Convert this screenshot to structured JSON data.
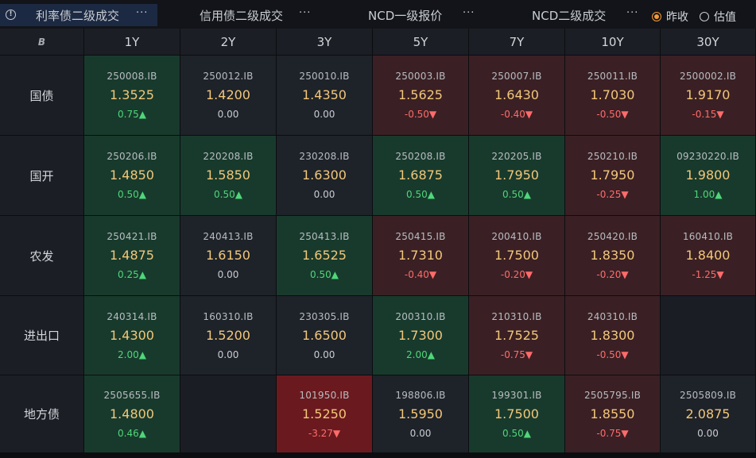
{
  "tabs": [
    {
      "label": "利率债二级成交",
      "active": true
    },
    {
      "label": "信用债二级成交",
      "active": false
    },
    {
      "label": "NCD一级报价",
      "active": false
    },
    {
      "label": "NCD二级成交",
      "active": false
    }
  ],
  "more_label": "···",
  "radio": [
    {
      "label": "昨收",
      "checked": true
    },
    {
      "label": "估值",
      "checked": false
    }
  ],
  "columns": [
    "1Y",
    "2Y",
    "3Y",
    "5Y",
    "7Y",
    "10Y",
    "30Y"
  ],
  "rows": [
    {
      "label": "国债",
      "cells": [
        {
          "code": "250008.IB",
          "price": "1.3525",
          "chg": "0.75▲",
          "dir": "up",
          "bg": "green"
        },
        {
          "code": "250012.IB",
          "price": "1.4200",
          "chg": "0.00",
          "dir": "flat",
          "bg": "neutral"
        },
        {
          "code": "250010.IB",
          "price": "1.4350",
          "chg": "0.00",
          "dir": "flat",
          "bg": "neutral"
        },
        {
          "code": "250003.IB",
          "price": "1.5625",
          "chg": "-0.50▼",
          "dir": "down",
          "bg": "red"
        },
        {
          "code": "250007.IB",
          "price": "1.6430",
          "chg": "-0.40▼",
          "dir": "down",
          "bg": "red"
        },
        {
          "code": "250011.IB",
          "price": "1.7030",
          "chg": "-0.50▼",
          "dir": "down",
          "bg": "red"
        },
        {
          "code": "2500002.IB",
          "price": "1.9170",
          "chg": "-0.15▼",
          "dir": "down",
          "bg": "red"
        }
      ]
    },
    {
      "label": "国开",
      "cells": [
        {
          "code": "250206.IB",
          "price": "1.4850",
          "chg": "0.50▲",
          "dir": "up",
          "bg": "green"
        },
        {
          "code": "220208.IB",
          "price": "1.5850",
          "chg": "0.50▲",
          "dir": "up",
          "bg": "green"
        },
        {
          "code": "230208.IB",
          "price": "1.6300",
          "chg": "0.00",
          "dir": "flat",
          "bg": "neutral"
        },
        {
          "code": "250208.IB",
          "price": "1.6875",
          "chg": "0.50▲",
          "dir": "up",
          "bg": "green"
        },
        {
          "code": "220205.IB",
          "price": "1.7950",
          "chg": "0.50▲",
          "dir": "up",
          "bg": "green"
        },
        {
          "code": "250210.IB",
          "price": "1.7950",
          "chg": "-0.25▼",
          "dir": "down",
          "bg": "red"
        },
        {
          "code": "09230220.IB",
          "price": "1.9800",
          "chg": "1.00▲",
          "dir": "up",
          "bg": "green"
        }
      ]
    },
    {
      "label": "农发",
      "cells": [
        {
          "code": "250421.IB",
          "price": "1.4875",
          "chg": "0.25▲",
          "dir": "up",
          "bg": "green"
        },
        {
          "code": "240413.IB",
          "price": "1.6150",
          "chg": "0.00",
          "dir": "flat",
          "bg": "neutral"
        },
        {
          "code": "250413.IB",
          "price": "1.6525",
          "chg": "0.50▲",
          "dir": "up",
          "bg": "green"
        },
        {
          "code": "250415.IB",
          "price": "1.7310",
          "chg": "-0.40▼",
          "dir": "down",
          "bg": "red"
        },
        {
          "code": "200410.IB",
          "price": "1.7500",
          "chg": "-0.20▼",
          "dir": "down",
          "bg": "red"
        },
        {
          "code": "250420.IB",
          "price": "1.8350",
          "chg": "-0.20▼",
          "dir": "down",
          "bg": "red"
        },
        {
          "code": "160410.IB",
          "price": "1.8400",
          "chg": "-1.25▼",
          "dir": "down",
          "bg": "red"
        }
      ]
    },
    {
      "label": "进出口",
      "cells": [
        {
          "code": "240314.IB",
          "price": "1.4300",
          "chg": "2.00▲",
          "dir": "up",
          "bg": "green"
        },
        {
          "code": "160310.IB",
          "price": "1.5200",
          "chg": "0.00",
          "dir": "flat",
          "bg": "neutral"
        },
        {
          "code": "230305.IB",
          "price": "1.6500",
          "chg": "0.00",
          "dir": "flat",
          "bg": "neutral"
        },
        {
          "code": "200310.IB",
          "price": "1.7300",
          "chg": "2.00▲",
          "dir": "up",
          "bg": "green"
        },
        {
          "code": "210310.IB",
          "price": "1.7525",
          "chg": "-0.75▼",
          "dir": "down",
          "bg": "red"
        },
        {
          "code": "240310.IB",
          "price": "1.8300",
          "chg": "-0.50▼",
          "dir": "down",
          "bg": "red"
        },
        {
          "code": "",
          "price": "",
          "chg": "",
          "dir": "flat",
          "bg": "empty"
        }
      ]
    },
    {
      "label": "地方债",
      "cells": [
        {
          "code": "2505655.IB",
          "price": "1.4800",
          "chg": "0.46▲",
          "dir": "up",
          "bg": "green"
        },
        {
          "code": "",
          "price": "",
          "chg": "",
          "dir": "flat",
          "bg": "empty"
        },
        {
          "code": "101950.IB",
          "price": "1.5250",
          "chg": "-3.27▼",
          "dir": "down",
          "bg": "strongred"
        },
        {
          "code": "198806.IB",
          "price": "1.5950",
          "chg": "0.00",
          "dir": "flat",
          "bg": "neutral"
        },
        {
          "code": "199301.IB",
          "price": "1.7500",
          "chg": "0.50▲",
          "dir": "up",
          "bg": "green"
        },
        {
          "code": "2505795.IB",
          "price": "1.8550",
          "chg": "-0.75▼",
          "dir": "down",
          "bg": "red"
        },
        {
          "code": "2505809.IB",
          "price": "2.0875",
          "chg": "0.00",
          "dir": "flat",
          "bg": "neutral"
        }
      ]
    }
  ],
  "colors": {
    "price": "#f2c77a",
    "up": "#4fd67a",
    "down": "#ff6b6b",
    "accent": "#f29a38",
    "green_cell": "#183a2c",
    "red_cell": "#3a2024",
    "strong_red_cell": "#6a1a1e"
  }
}
